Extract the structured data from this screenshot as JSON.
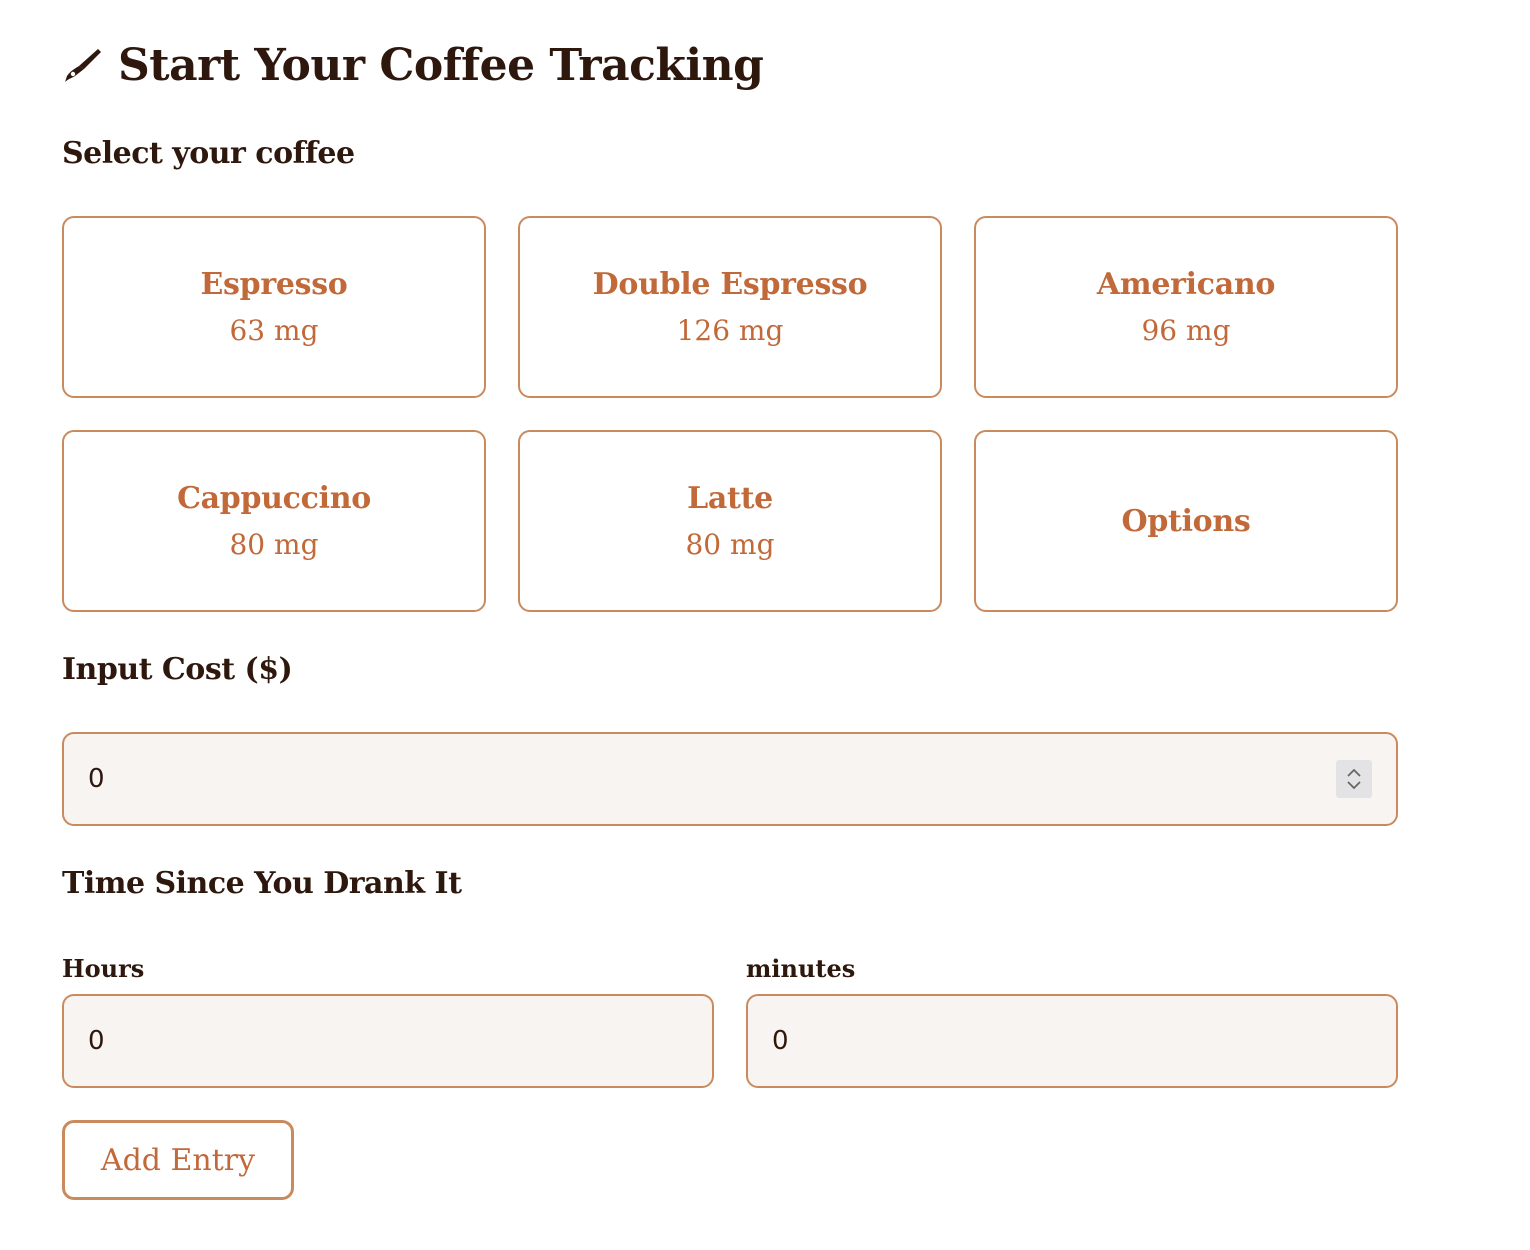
{
  "header": {
    "title": "Start Your Coffee Tracking",
    "icon": "pen-icon"
  },
  "coffee_section": {
    "label": "Select your coffee",
    "options": [
      {
        "name": "Espresso",
        "caffeine": "63 mg"
      },
      {
        "name": "Double Espresso",
        "caffeine": "126 mg"
      },
      {
        "name": "Americano",
        "caffeine": "96 mg"
      },
      {
        "name": "Cappuccino",
        "caffeine": "80 mg"
      },
      {
        "name": "Latte",
        "caffeine": "80 mg"
      },
      {
        "name": "Options",
        "caffeine": ""
      }
    ]
  },
  "cost": {
    "label": "Input Cost ($)",
    "value": "0"
  },
  "time": {
    "label": "Time Since You Drank It",
    "hours_label": "Hours",
    "hours_value": "0",
    "minutes_label": "minutes",
    "minutes_value": "0"
  },
  "actions": {
    "add_label": "Add Entry"
  },
  "colors": {
    "heading": "#2e170d",
    "accent": "#c2693a",
    "border": "#c98a5e",
    "field_bg": "#f8f4f1"
  }
}
